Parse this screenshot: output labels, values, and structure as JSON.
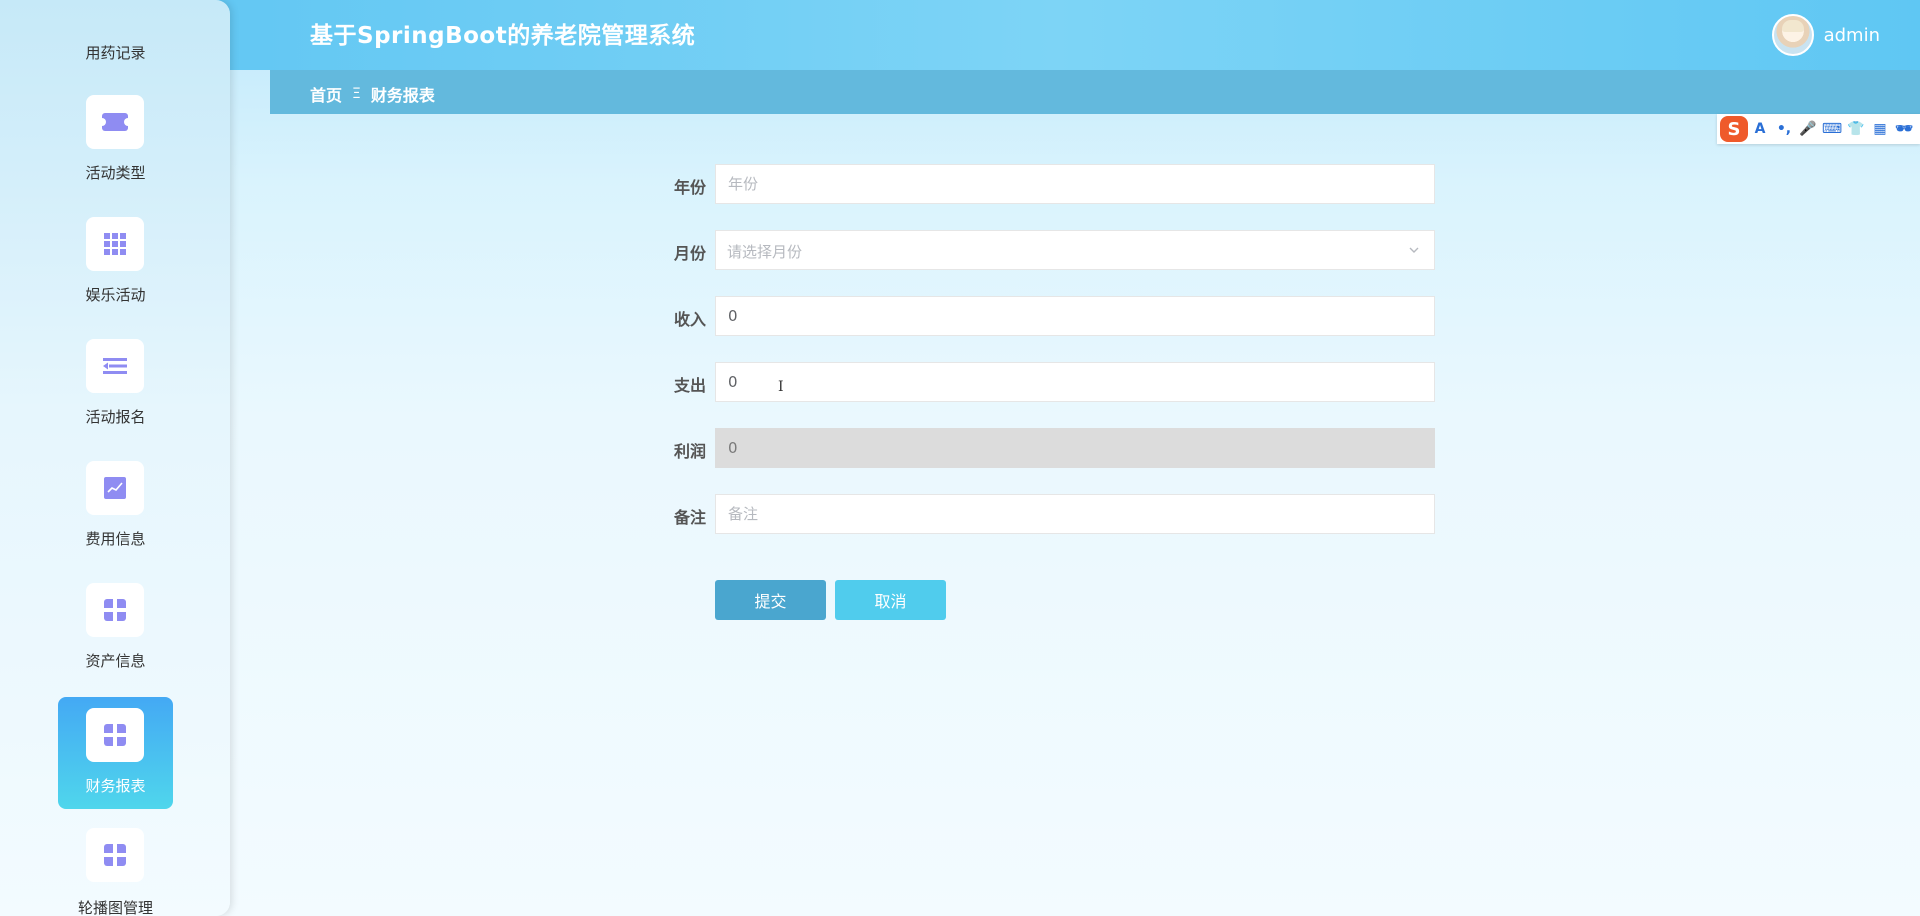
{
  "header": {
    "title": "基于SpringBoot的养老院管理系统",
    "username": "admin"
  },
  "breadcrumb": {
    "home": "首页",
    "separator": "Ξ",
    "current": "财务报表"
  },
  "ime_toolbar": {
    "logo": "S",
    "items": [
      "A",
      "•,",
      "🎤",
      "⌨",
      "👕",
      "▦",
      "🕶"
    ]
  },
  "sidebar": {
    "items": [
      {
        "label": "用药记录",
        "icon": "partial-icon"
      },
      {
        "label": "活动类型",
        "icon": "ticket-icon"
      },
      {
        "label": "娱乐活动",
        "icon": "grid-icon"
      },
      {
        "label": "活动报名",
        "icon": "list-icon"
      },
      {
        "label": "费用信息",
        "icon": "chart-icon"
      },
      {
        "label": "资产信息",
        "icon": "apps-icon"
      },
      {
        "label": "财务报表",
        "icon": "apps-icon",
        "active": true
      },
      {
        "label": "轮播图管理",
        "icon": "apps-icon"
      }
    ]
  },
  "form": {
    "year": {
      "label": "年份",
      "placeholder": "年份",
      "value": ""
    },
    "month": {
      "label": "月份",
      "placeholder": "请选择月份"
    },
    "income": {
      "label": "收入",
      "value": "0"
    },
    "expense": {
      "label": "支出",
      "value": "0"
    },
    "profit": {
      "label": "利润",
      "value": "0"
    },
    "remark": {
      "label": "备注",
      "placeholder": "备注",
      "value": ""
    }
  },
  "buttons": {
    "submit": "提交",
    "cancel": "取消"
  },
  "colors": {
    "header": "#5cc4f2",
    "breadcrumb_bar": "#63b9dd",
    "submit": "#4aa6cf",
    "cancel": "#50cced",
    "icon": "#8f8cf2"
  }
}
